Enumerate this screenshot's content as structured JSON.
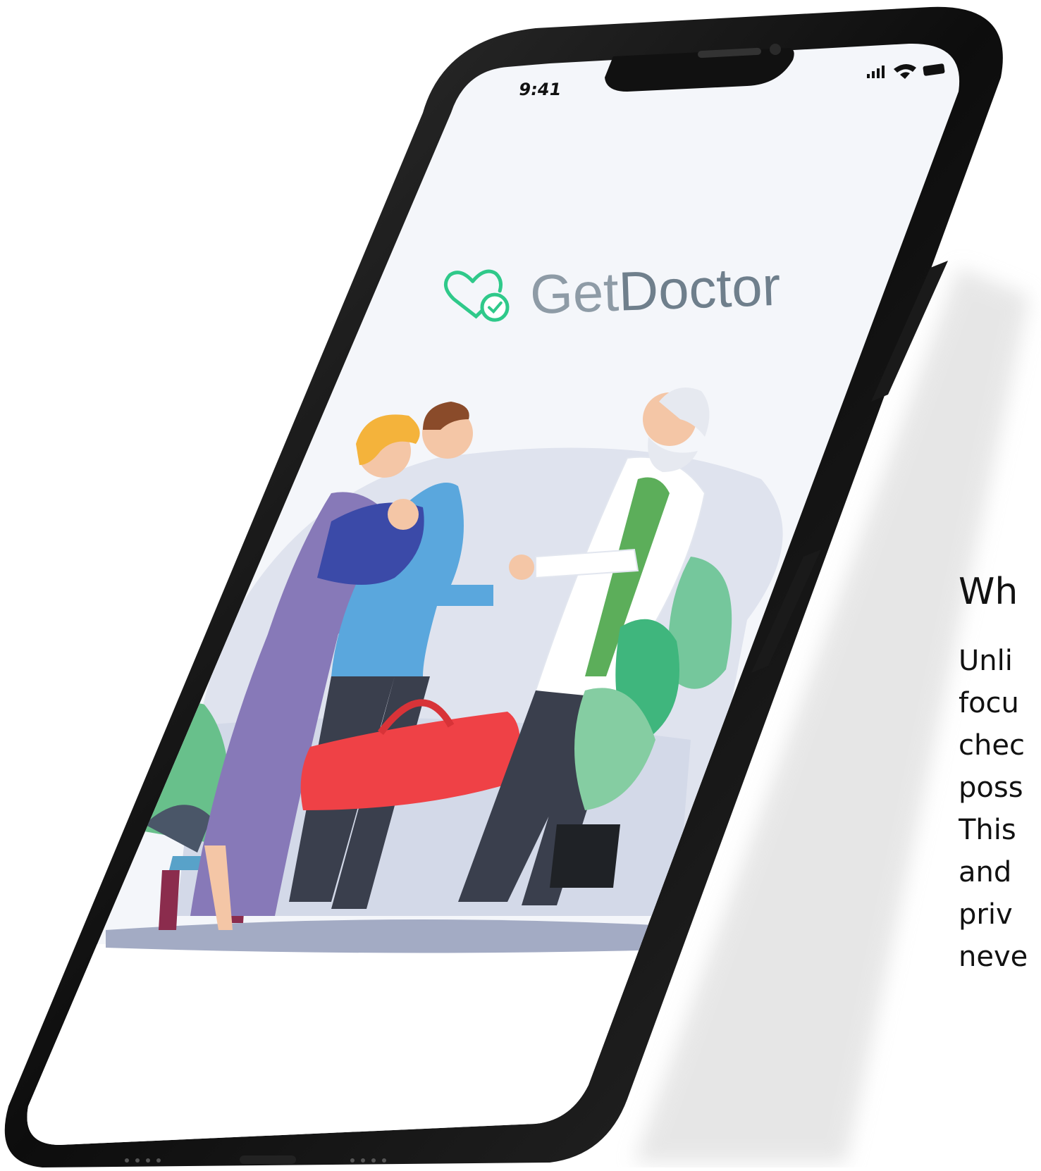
{
  "status_bar": {
    "time": "9:41",
    "icons": [
      "signal-icon",
      "wifi-icon",
      "battery-icon"
    ]
  },
  "app": {
    "name_part1": "Get",
    "name_part2": "Doctor",
    "logo_icon": "heart-check-icon"
  },
  "colors": {
    "brand_green": "#2fc98a",
    "logo_text": "#7c8a98",
    "phone_frame": "#111111",
    "screen_bg": "#f4f6fa",
    "bench_blob": "#d5dae8",
    "bag_red": "#ef4146",
    "dress_purple": "#8479b8",
    "shirt_blue": "#5aa7dd",
    "leaf_green": "#4fb77a"
  },
  "side_text": {
    "heading": "Wh",
    "lines": [
      "Unli",
      "focu",
      "chec",
      "poss",
      "This",
      "and",
      "priv",
      "neve"
    ]
  }
}
